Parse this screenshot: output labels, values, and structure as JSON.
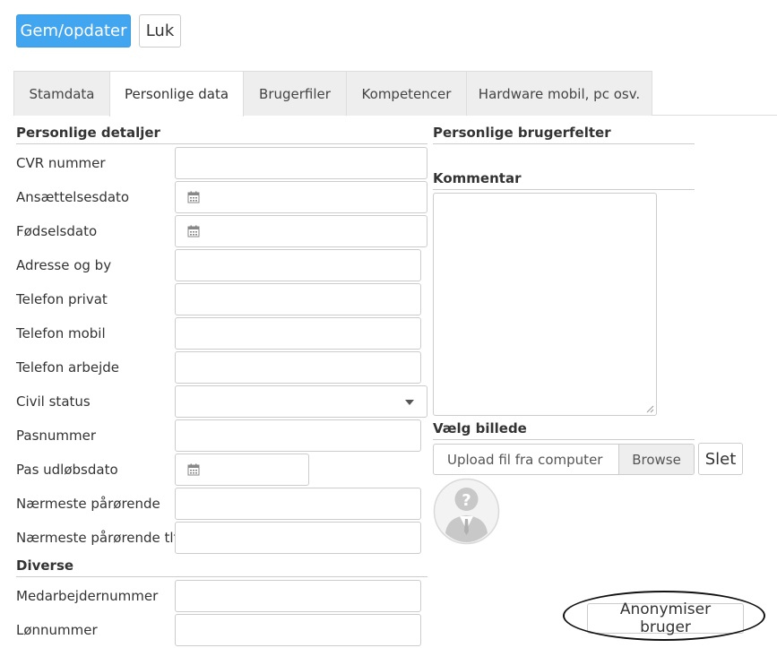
{
  "toolbar": {
    "save_label": "Gem/opdater",
    "close_label": "Luk"
  },
  "tabs": [
    {
      "label": "Stamdata",
      "active": false
    },
    {
      "label": "Personlige data",
      "active": true
    },
    {
      "label": "Brugerfiler",
      "active": false
    },
    {
      "label": "Kompetencer",
      "active": false
    },
    {
      "label": "Hardware mobil, pc osv.",
      "active": false
    }
  ],
  "sections": {
    "personal_details": "Personlige detaljer",
    "personal_user_fields": "Personlige brugerfelter",
    "comment": "Kommentar",
    "choose_image": "Vælg billede",
    "misc": "Diverse"
  },
  "fields": {
    "cvr": {
      "label": "CVR nummer",
      "value": ""
    },
    "employment_date": {
      "label": "Ansættelsesdato",
      "value": ""
    },
    "birth_date": {
      "label": "Fødselsdato",
      "value": ""
    },
    "address": {
      "label": "Adresse og by",
      "value": ""
    },
    "phone_private": {
      "label": "Telefon privat",
      "value": ""
    },
    "phone_mobile": {
      "label": "Telefon mobil",
      "value": ""
    },
    "phone_work": {
      "label": "Telefon arbejde",
      "value": ""
    },
    "civil_status": {
      "label": "Civil status",
      "value": ""
    },
    "passport_number": {
      "label": "Pasnummer",
      "value": ""
    },
    "passport_expiry": {
      "label": "Pas udløbsdato",
      "value": ""
    },
    "next_of_kin": {
      "label": "Nærmeste pårørende",
      "value": ""
    },
    "next_of_kin_phone": {
      "label": "Nærmeste pårørende tlf.",
      "value": ""
    },
    "employee_number": {
      "label": "Medarbejdernummer",
      "value": ""
    },
    "payroll_number": {
      "label": "Lønnummer",
      "value": ""
    }
  },
  "upload": {
    "placeholder": "Upload fil fra computer",
    "browse_label": "Browse",
    "delete_label": "Slet"
  },
  "actions": {
    "anonymize_label": "Anonymiser bruger"
  },
  "colors": {
    "primary": "#42a5ef",
    "tab_inactive": "#eeeeee",
    "border": "#cccccc"
  }
}
